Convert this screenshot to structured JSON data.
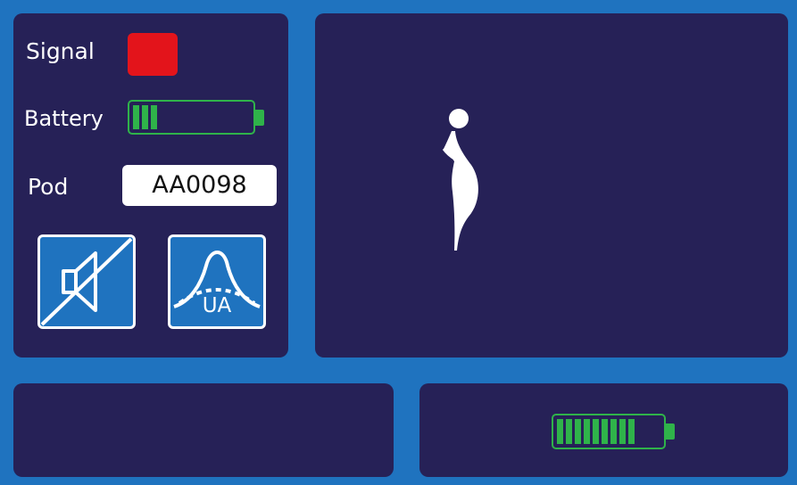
{
  "status": {
    "signal_label": "Signal",
    "signal_color": "#e3141b",
    "battery_label": "Battery",
    "battery_level_cells": 3,
    "battery_color": "#2fb34a",
    "pod_label": "Pod",
    "pod_id": "AA0098"
  },
  "buttons": {
    "mute_icon": "speaker-muted-icon",
    "ua_icon": "ua-contraction-curve-icon",
    "ua_label": "UA"
  },
  "figure": {
    "icon": "pregnant-woman-silhouette-icon"
  },
  "bottom_right": {
    "battery_icon": "battery-full-icon",
    "battery_level_cells": 9
  },
  "colors": {
    "background": "#1f73bf",
    "panel": "#262157",
    "text": "#ffffff"
  }
}
